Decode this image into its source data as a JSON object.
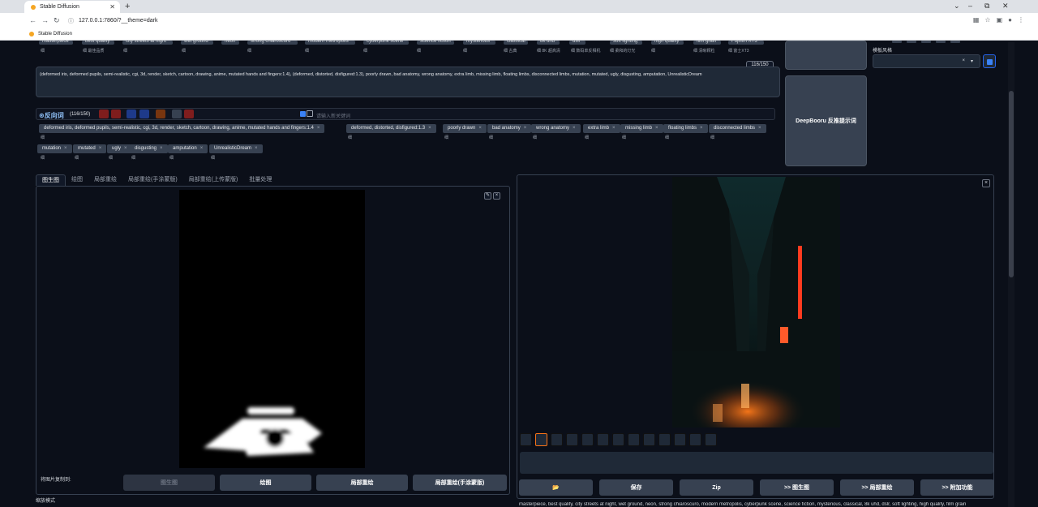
{
  "browser": {
    "tab_title": "Stable Diffusion",
    "url": "127.0.0.1:7860/?__theme=dark",
    "bookmark": "Stable Diffusion",
    "win_min": "⌄",
    "win_dash": "–",
    "win_max": "⧉",
    "win_close": "✕"
  },
  "top_tags": [
    {
      "label": "masterpiece",
      "sub": "细"
    },
    {
      "label": "best quality",
      "sub": "细 最佳品质"
    },
    {
      "label": "city streets at night",
      "sub": "细"
    },
    {
      "label": "wet ground",
      "sub": "细"
    },
    {
      "label": "neon",
      "sub": "细"
    },
    {
      "label": "strong chiaroscuro",
      "sub": "细"
    },
    {
      "label": "modern metropolis",
      "sub": "细"
    },
    {
      "label": "cyberpunk scene",
      "sub": "细"
    },
    {
      "label": "science fiction",
      "sub": "细"
    },
    {
      "label": "mysterious",
      "sub": "细"
    },
    {
      "label": "classical",
      "sub": "细 古典"
    },
    {
      "label": "8k uhd",
      "sub": "细 8K 超高清"
    },
    {
      "label": "dslr",
      "sub": "细 数码单反相机"
    },
    {
      "label": "soft lighting",
      "sub": "细 柔和的灯光"
    },
    {
      "label": "high quality",
      "sub": "细"
    },
    {
      "label": "film grain",
      "sub": "细 清晰颗粒"
    },
    {
      "label": "Fujifilm XT3",
      "sub": "细 富士XT3"
    }
  ],
  "counter_top": "116/150",
  "negative_prompt_text": "(deformed iris, deformed pupils, semi-realistic, cgi, 3d, render, sketch, cartoon, drawing, anime, mutated hands and fingers:1.4), (deformed, distorted, disfigured:1.3), poorly drawn, bad anatomy, wrong anatomy, extra limb, missing limb, floating limbs, disconnected limbs, mutation, mutated, ugly, disgusting, amputation, UnrealisticDream",
  "neg_section": {
    "label": "反向词",
    "count": "(116/150)",
    "keyword_placeholder": "请输入新关键词"
  },
  "neg_tags": [
    {
      "label": "deformed iris, deformed pupils, semi-realistic, cgi, 3d, render, sketch, cartoon, drawing, anime, mutated hands and fingers:1.4"
    },
    {
      "label": "deformed, distorted, disfigured:1.3"
    },
    {
      "label": "poorly drawn"
    },
    {
      "label": "bad anatomy"
    },
    {
      "label": "wrong anatomy"
    },
    {
      "label": "extra limb"
    },
    {
      "label": "missing limb"
    },
    {
      "label": "floating limbs"
    },
    {
      "label": "disconnected limbs"
    },
    {
      "label": "mutation"
    },
    {
      "label": "mutated"
    },
    {
      "label": "ugly"
    },
    {
      "label": "disgusting"
    },
    {
      "label": "amputation"
    },
    {
      "label": "UnrealisticDream"
    }
  ],
  "grid_glyph": "细",
  "tag_close": "×",
  "deepbooru_btn": "DeepBooru 反推提示词",
  "template_label": "模板风格",
  "select_clear": "×",
  "select_caret": "▾",
  "img_tabs": [
    "图生图",
    "绘图",
    "局部重绘",
    "局部重绘(手涂蒙版)",
    "局部重绘(上传蒙版)",
    "批量处理"
  ],
  "canvas_icons": {
    "edit": "✎",
    "close": "×"
  },
  "copy_label": "将图片复制到:",
  "copy_buttons": [
    "图生图",
    "绘图",
    "局部重绘",
    "局部重绘(手涂蒙版)"
  ],
  "scale_mode": "缩放模式",
  "output_close": "×",
  "action_buttons": [
    "📂",
    "保存",
    "Zip",
    ">> 图生图",
    ">> 局部重绘",
    ">> 附加功能"
  ],
  "caption": "masterpiece, best quality, city streets at night, wet ground, neon, strong chiaroscuro, modern metropolis, cyberpunk scene, science fiction, mysterious, classical, 8k uhd, dslr, soft lighting, high quality, film grain"
}
